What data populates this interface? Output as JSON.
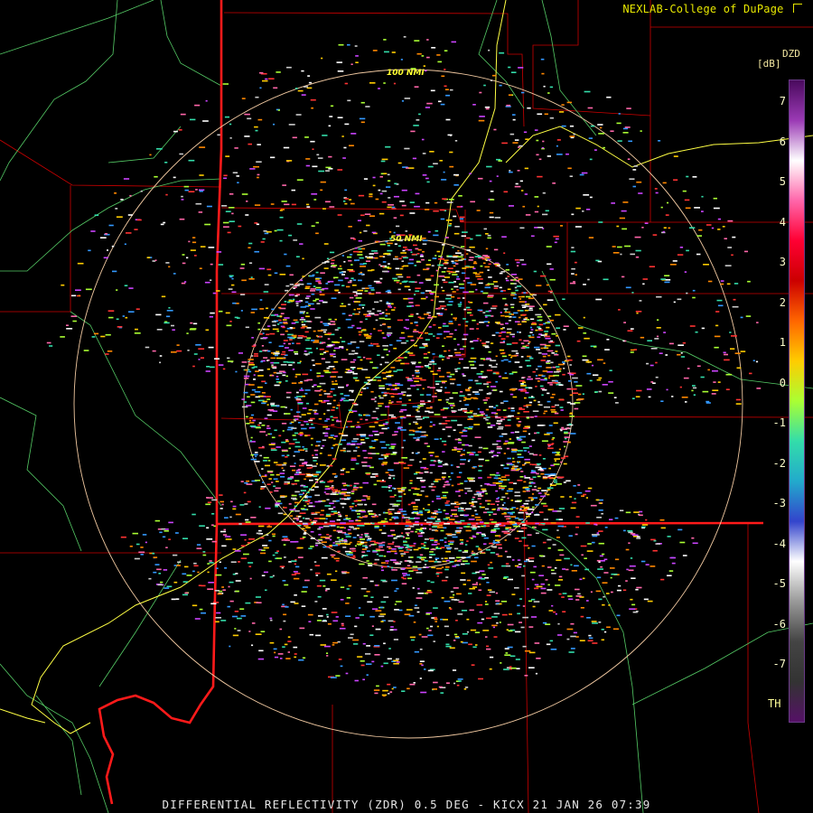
{
  "header": {
    "credit": "NEXLAB-College of DuPage",
    "credit_icon": "cursor-arrow-icon"
  },
  "legend": {
    "product": "DZD",
    "unit": "[dB]",
    "ticks": [
      "7",
      "6",
      "5",
      "4",
      "3",
      "2",
      "1",
      "0",
      "-1",
      "-2",
      "-3",
      "-4",
      "-5",
      "-6",
      "-7"
    ],
    "below_threshold": "TH",
    "gradient": [
      "#4a0a5e",
      "#9b3ab5",
      "#ffffff",
      "#ff66aa",
      "#ff0033",
      "#cc0000",
      "#ff6600",
      "#ffcc00",
      "#aaff33",
      "#33ddaa",
      "#22aacc",
      "#3344cc",
      "#ffffff",
      "#999999",
      "#444444",
      "#333333",
      "#551166"
    ]
  },
  "rings": {
    "inner_label": "50 NMI",
    "outer_label": "100 NMI"
  },
  "footer": {
    "title": "DIFFERENTIAL REFLECTIVITY (ZDR) 0.5 DEG - KICX 21 JAN 26 07:39"
  },
  "colors": {
    "state_line": "#ff1a1a",
    "county_line": "#cc0000",
    "river": "#ffff44",
    "terrain": "#55cc66",
    "range_ring": "#f0c8a0"
  }
}
